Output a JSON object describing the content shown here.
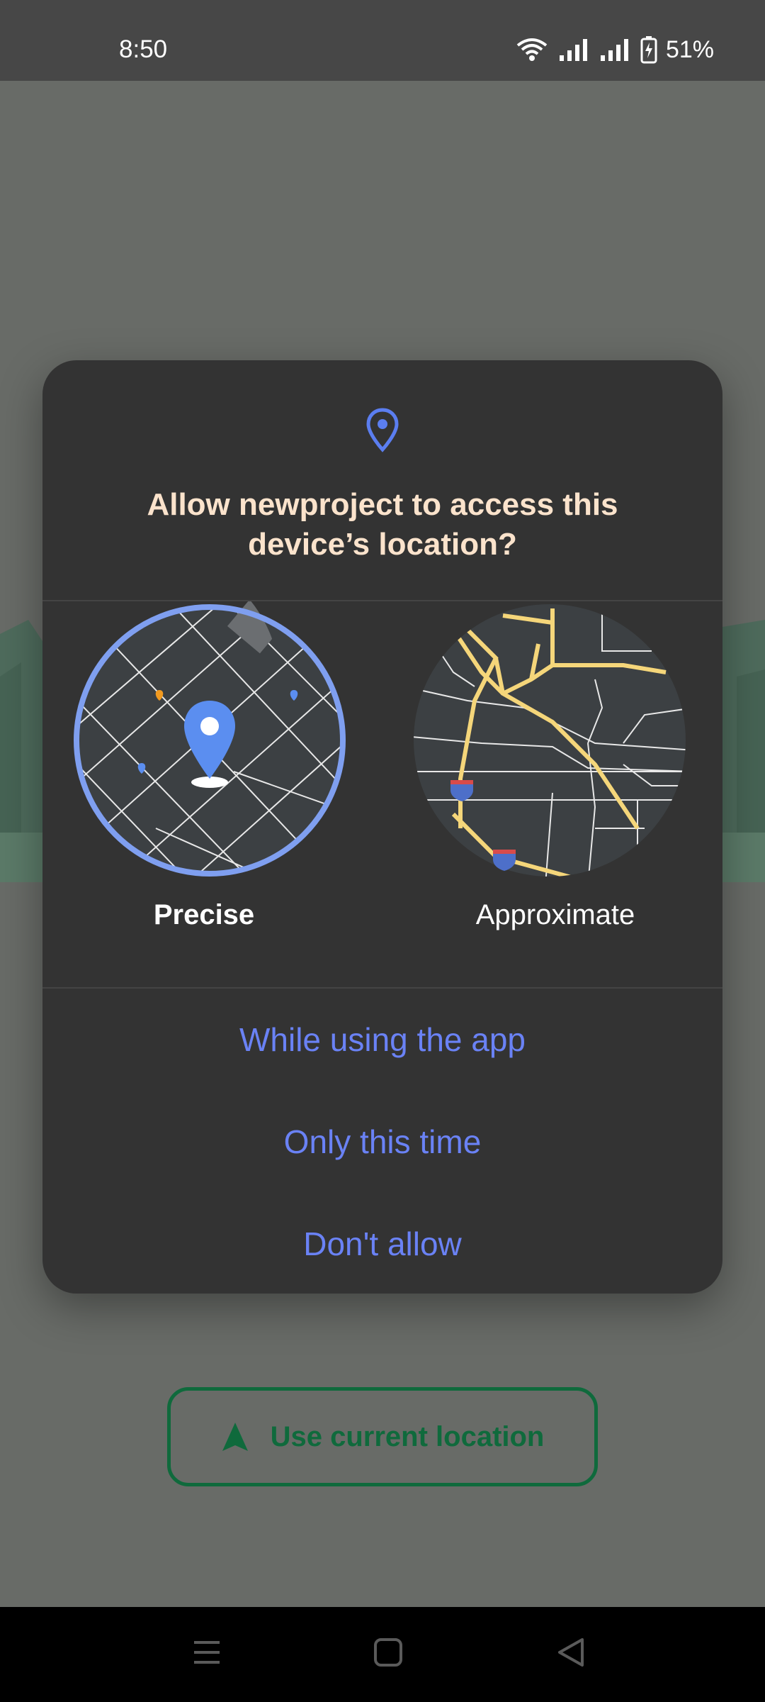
{
  "status_bar": {
    "time": "8:50",
    "battery_percent": "51%",
    "icons": [
      "wifi-icon",
      "signal-icon",
      "signal-icon",
      "battery-charging-icon"
    ]
  },
  "background": {
    "use_location_button": "Use current location",
    "button_icon": "navigation-arrow-icon",
    "accent_color": "#0f6a3c"
  },
  "dialog": {
    "icon": "location-pin-icon",
    "title": "Allow newproject to access this device’s location?",
    "options": [
      {
        "label": "Precise",
        "selected": true,
        "map": "precise-map-icon"
      },
      {
        "label": "Approximate",
        "selected": false,
        "map": "approximate-map-icon"
      }
    ],
    "actions": [
      "While using the app",
      "Only this time",
      "Don't allow"
    ],
    "action_color": "#6a82f5",
    "title_color": "#fbe3cc"
  },
  "nav_bar": {
    "buttons": [
      "recents-icon",
      "home-icon",
      "back-icon"
    ]
  }
}
